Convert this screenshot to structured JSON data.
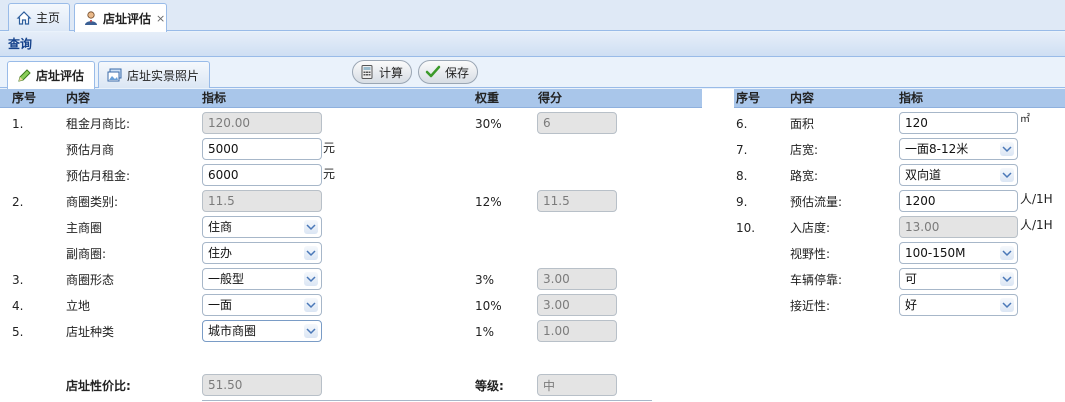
{
  "top_tabs": [
    {
      "label": "主页",
      "icon": "home-icon"
    },
    {
      "label": "店址评估",
      "icon": "user-icon",
      "close": "×"
    }
  ],
  "query_title": "查询",
  "inner_tabs": [
    {
      "label": "店址评估",
      "icon": "pencil-icon"
    },
    {
      "label": "店址实景照片",
      "icon": "photo-icon"
    }
  ],
  "toolbar": {
    "calc_label": "计算",
    "save_label": "保存"
  },
  "left_table": {
    "headers": {
      "no": "序号",
      "content": "内容",
      "indicator": "指标",
      "weight": "权重",
      "score": "得分"
    },
    "rows": [
      {
        "no": "1.",
        "content": "租金月商比:",
        "value": "120.00",
        "weight": "30%",
        "score": "6"
      },
      {
        "no": "",
        "content": "预估月商",
        "value": "5000",
        "unit": "元"
      },
      {
        "no": "",
        "content": "预估月租金:",
        "value": "6000",
        "unit": "元"
      },
      {
        "no": "2.",
        "content": "商圈类别:",
        "value": "11.5",
        "weight": "12%",
        "score": "11.5"
      },
      {
        "no": "",
        "content": "主商圈",
        "value": "住商"
      },
      {
        "no": "",
        "content": "副商圈:",
        "value": "住办"
      },
      {
        "no": "3.",
        "content": "商圈形态",
        "value": "一般型",
        "weight": "3%",
        "score": "3.00"
      },
      {
        "no": "4.",
        "content": "立地",
        "value": "一面",
        "weight": "10%",
        "score": "3.00"
      },
      {
        "no": "5.",
        "content": "店址种类",
        "value": "城市商圈",
        "weight": "1%",
        "score": "1.00"
      }
    ],
    "cost_ratio_label": "店址性价比:",
    "cost_ratio_value": "51.50",
    "grade_label": "等级:",
    "grade_value": "中"
  },
  "right_table": {
    "headers": {
      "no": "序号",
      "content": "内容",
      "indicator": "指标"
    },
    "rows": [
      {
        "no": "6.",
        "content": "面积",
        "value": "120",
        "unit": "㎡"
      },
      {
        "no": "7.",
        "content": "店宽:",
        "value": "一面8-12米"
      },
      {
        "no": "8.",
        "content": "路宽:",
        "value": "双向道"
      },
      {
        "no": "9.",
        "content": "预估流量:",
        "value": "1200",
        "unit": "人/1H"
      },
      {
        "no": "10.",
        "content": "入店度:",
        "value": "13.00",
        "unit": "人/1H"
      },
      {
        "no": "",
        "content": "视野性:",
        "value": "100-150M"
      },
      {
        "no": "",
        "content": "车辆停靠:",
        "value": "可"
      },
      {
        "no": "",
        "content": "接近性:",
        "value": "好"
      }
    ]
  }
}
